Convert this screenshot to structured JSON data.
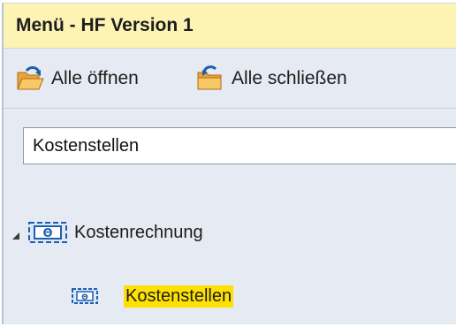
{
  "window": {
    "title": "Menü - HF Version 1"
  },
  "toolbar": {
    "open_all": {
      "label": "Alle öffnen",
      "icon": "open-folder-icon"
    },
    "close_all": {
      "label": "Alle schließen",
      "icon": "close-folder-icon"
    }
  },
  "search": {
    "value": "Kostenstellen",
    "placeholder": ""
  },
  "tree": {
    "root": {
      "label": "Kostenrechnung",
      "expanded": true,
      "icon": "cost-accounting-icon"
    },
    "child": {
      "label": "Kostenstellen",
      "highlighted": true,
      "icon": "cost-center-icon"
    }
  },
  "colors": {
    "title_bar": "#fdf3b3",
    "panel": "#e6eaf2",
    "highlight": "#ffe100",
    "icon_blue": "#1f5fae",
    "icon_orange": "#f0a52a"
  }
}
